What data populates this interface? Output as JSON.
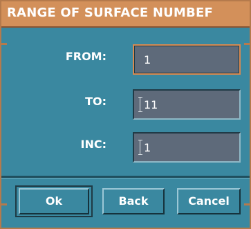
{
  "dialog": {
    "title": "RANGE OF SURFACE NUMBEF",
    "fields": [
      {
        "label": "FROM:",
        "value": "1"
      },
      {
        "label": "TO:",
        "value": "11"
      },
      {
        "label": "INC:",
        "value": "1"
      }
    ],
    "buttons": {
      "ok": "Ok",
      "back": "Back",
      "cancel": "Cancel"
    }
  },
  "colors": {
    "title_bar": "#d3905a",
    "panel": "#3a88a0",
    "field_bg": "#5e6a7a",
    "focus_border": "#d88a52"
  }
}
